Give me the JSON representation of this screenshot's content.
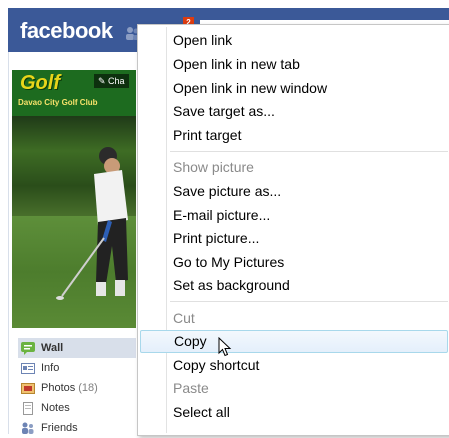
{
  "header": {
    "logo": "facebook",
    "notification_count": "2"
  },
  "profile": {
    "picture_text": "Golf",
    "picture_caption": "Davao City Golf Club",
    "change_label": "Cha",
    "nav": [
      {
        "label": "Wall",
        "count": "",
        "icon": "wall-icon",
        "active": true
      },
      {
        "label": "Info",
        "count": "",
        "icon": "info-icon",
        "active": false
      },
      {
        "label": "Photos",
        "count": "(18)",
        "icon": "photos-icon",
        "active": false
      },
      {
        "label": "Notes",
        "count": "",
        "icon": "notes-icon",
        "active": false
      },
      {
        "label": "Friends",
        "count": "",
        "icon": "friends-icon",
        "active": false
      }
    ]
  },
  "context_menu": {
    "groups": [
      [
        "Open link",
        "Open link in new tab",
        "Open link in new window",
        "Save target as...",
        "Print target"
      ],
      [
        "Show picture",
        "Save picture as...",
        "E-mail picture...",
        "Print picture...",
        "Go to My Pictures",
        "Set as background"
      ],
      [
        "Cut",
        "Copy",
        "Copy shortcut",
        "Paste",
        "Select all"
      ]
    ],
    "items": [
      {
        "label": "Open link",
        "disabled": false
      },
      {
        "label": "Open link in new tab",
        "disabled": false
      },
      {
        "label": "Open link in new window",
        "disabled": false
      },
      {
        "label": "Save target as...",
        "disabled": false
      },
      {
        "label": "Print target",
        "disabled": false
      },
      {
        "label": "Show picture",
        "disabled": true
      },
      {
        "label": "Save picture as...",
        "disabled": false
      },
      {
        "label": "E-mail picture...",
        "disabled": false
      },
      {
        "label": "Print picture...",
        "disabled": false
      },
      {
        "label": "Go to My Pictures",
        "disabled": false
      },
      {
        "label": "Set as background",
        "disabled": false
      },
      {
        "label": "Cut",
        "disabled": true
      },
      {
        "label": "Copy",
        "disabled": false,
        "hover": true
      },
      {
        "label": "Copy shortcut",
        "disabled": false
      },
      {
        "label": "Paste",
        "disabled": true
      },
      {
        "label": "Select all",
        "disabled": false
      }
    ]
  },
  "colors": {
    "facebook_blue": "#3b5998",
    "menu_hover": "#e4effb",
    "disabled_text": "#8a8a8a"
  }
}
